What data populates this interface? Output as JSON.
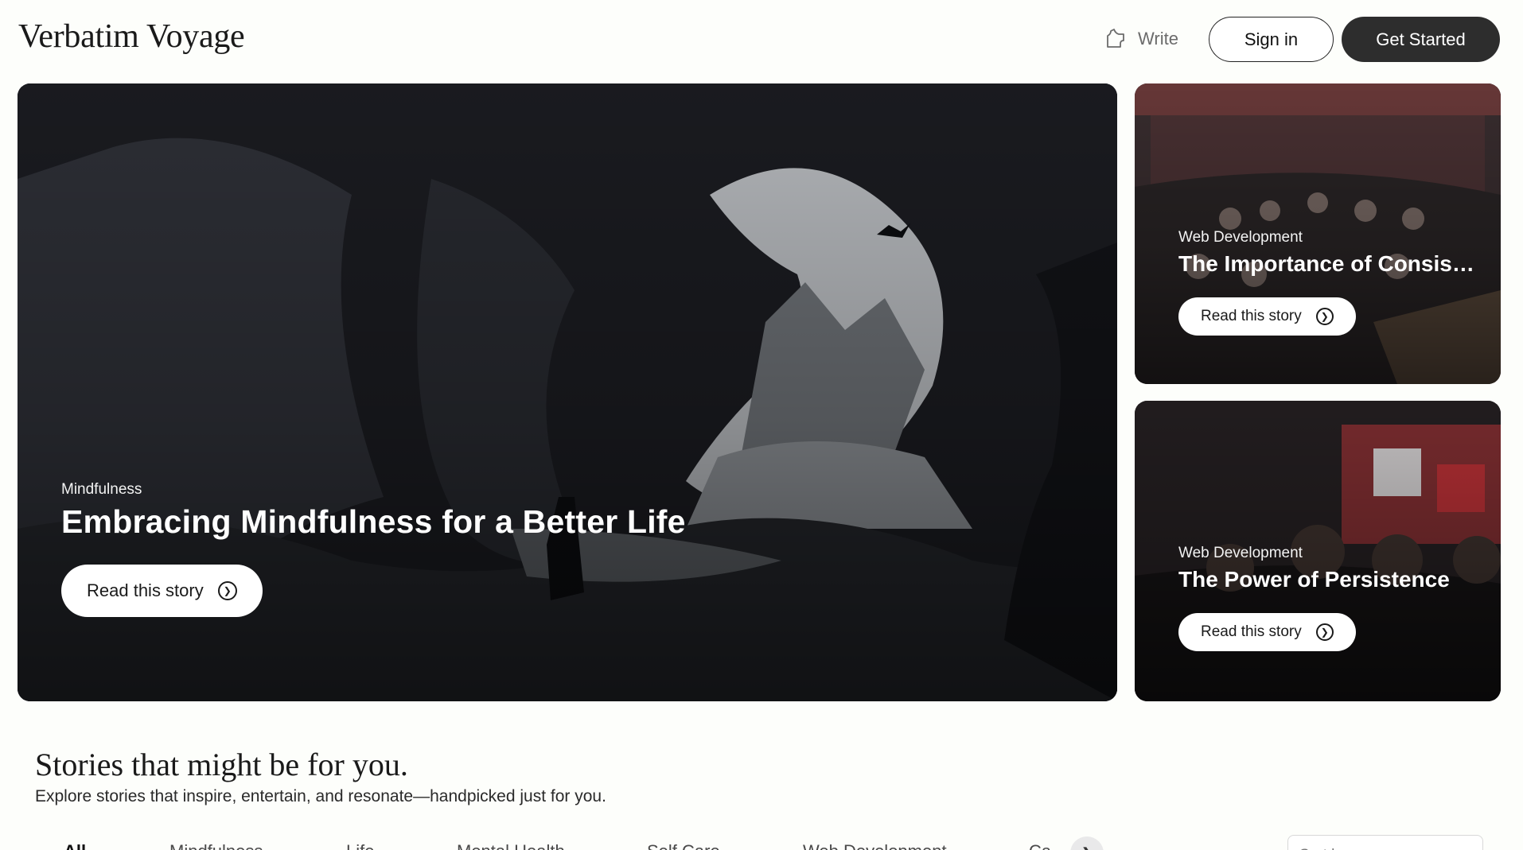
{
  "header": {
    "logo": "Verbatim Voyage",
    "write_label": "Write",
    "signin_label": "Sign in",
    "get_started_label": "Get Started"
  },
  "featured": {
    "main": {
      "category": "Mindfulness",
      "title": "Embracing Mindfulness for a Better Life",
      "read_label": "Read this story"
    },
    "side": [
      {
        "category": "Web Development",
        "title": "The Importance of Consistency",
        "read_label": "Read this story"
      },
      {
        "category": "Web Development",
        "title": "The Power of Persistence",
        "read_label": "Read this story"
      }
    ]
  },
  "stories": {
    "title": "Stories that might be for you.",
    "subtitle": "Explore stories that inspire, entertain, and resonate—handpicked just for you.",
    "tabs": [
      "All",
      "Mindfulness",
      "Life",
      "Mental Health",
      "Self Care",
      "Web Development",
      "Ca"
    ],
    "active_tab": "All",
    "sort_placeholder": "Sort by"
  },
  "icons": {
    "write": "write-icon",
    "arrow": "chevron-right-circle-icon",
    "tabs_next": "chevron-right-icon"
  },
  "colors": {
    "background": "#fdfefb",
    "primary_button": "#2d2d2d"
  }
}
